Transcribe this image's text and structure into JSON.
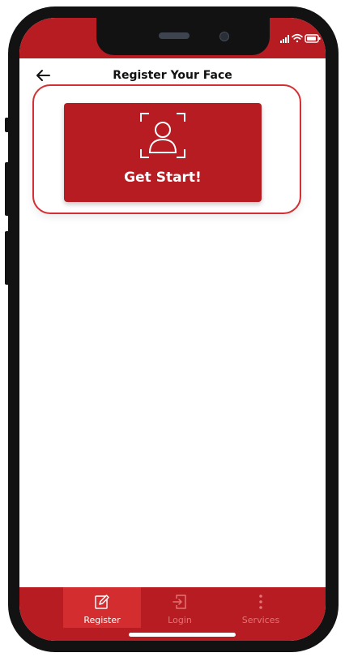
{
  "header": {
    "title": "Register Your Face",
    "back_icon": "arrow-left-icon"
  },
  "main": {
    "start_button_label": "Get Start!",
    "start_button_icon": "face-scan-icon"
  },
  "bottom_nav": {
    "items": [
      {
        "label": "Register",
        "icon": "edit-icon",
        "active": true
      },
      {
        "label": "Login",
        "icon": "login-icon",
        "active": false
      },
      {
        "label": "Services",
        "icon": "more-vertical-icon",
        "active": false
      }
    ]
  },
  "status_bar": {
    "icons": [
      "signal-icon",
      "wifi-icon",
      "battery-icon"
    ]
  },
  "colors": {
    "brand_red": "#b71c23",
    "active_tab": "#d32d2f",
    "highlight_border": "#d32f35",
    "inactive_tab_text": "#e57373",
    "active_tab_text": "#ffffff"
  }
}
